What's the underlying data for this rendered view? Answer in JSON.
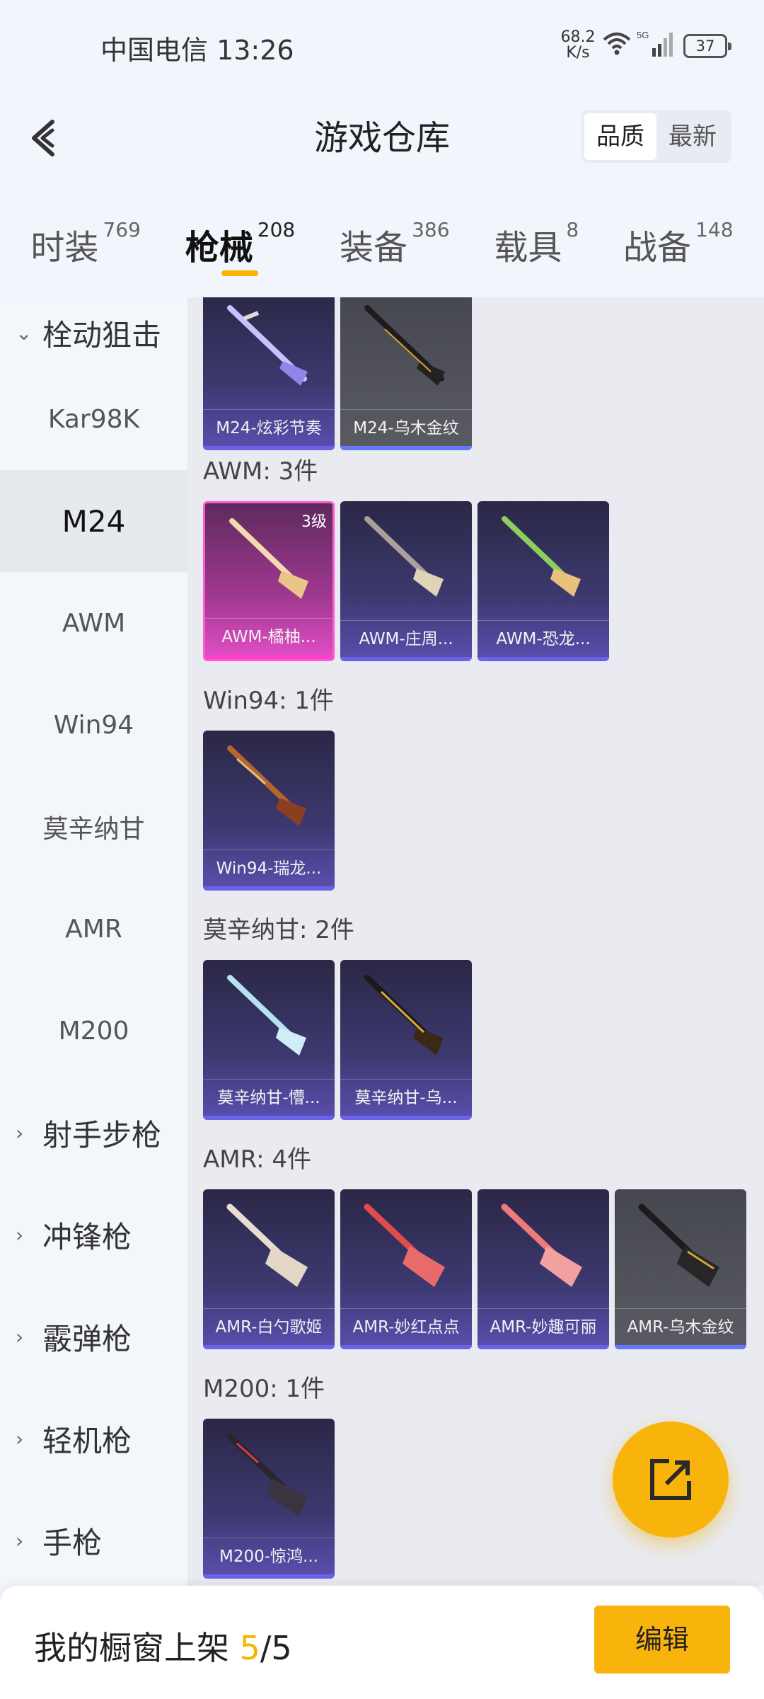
{
  "status": {
    "carrier_time": "中国电信 13:26",
    "net_speed_value": "68.2",
    "net_speed_unit": "K/s",
    "battery": "37"
  },
  "header": {
    "title": "游戏仓库",
    "sort_options": [
      "品质",
      "最新"
    ],
    "sort_selected": "品质"
  },
  "categories": [
    {
      "label": "时装",
      "count": "769"
    },
    {
      "label": "枪械",
      "count": "208",
      "active": true
    },
    {
      "label": "装备",
      "count": "386"
    },
    {
      "label": "载具",
      "count": "8"
    },
    {
      "label": "战备",
      "count": "148"
    }
  ],
  "sidebar": {
    "group_open": "栓动狙击",
    "sub_items": [
      "Kar98K",
      "M24",
      "AWM",
      "Win94",
      "莫辛纳甘",
      "AMR",
      "M200"
    ],
    "selected": "M24",
    "groups_closed": [
      "射手步枪",
      "冲锋枪",
      "霰弹枪",
      "轻机枪",
      "手枪"
    ]
  },
  "sections": [
    {
      "title": "",
      "items": [
        {
          "name": "M24-炫彩节奏",
          "style": "purple"
        },
        {
          "name": "M24-乌木金纹",
          "style": "gray"
        }
      ]
    },
    {
      "title": "AWM: 3件",
      "items": [
        {
          "name": "AWM-橘柚...",
          "style": "pink",
          "level": "3级"
        },
        {
          "name": "AWM-庄周...",
          "style": "purple"
        },
        {
          "name": "AWM-恐龙...",
          "style": "purple"
        }
      ]
    },
    {
      "title": "Win94: 1件",
      "items": [
        {
          "name": "Win94-瑞龙...",
          "style": "purple"
        }
      ]
    },
    {
      "title": "莫辛纳甘: 2件",
      "items": [
        {
          "name": "莫辛纳甘-懵...",
          "style": "purple"
        },
        {
          "name": "莫辛纳甘-乌...",
          "style": "purple"
        }
      ]
    },
    {
      "title": "AMR: 4件",
      "items": [
        {
          "name": "AMR-白勺歌姬",
          "style": "purple"
        },
        {
          "name": "AMR-妙红点点",
          "style": "purple"
        },
        {
          "name": "AMR-妙趣可丽",
          "style": "purple"
        },
        {
          "name": "AMR-乌木金纹",
          "style": "gray"
        }
      ]
    },
    {
      "title": "M200: 1件",
      "items": [
        {
          "name": "M200-惊鸿...",
          "style": "purple"
        }
      ]
    }
  ],
  "bottom": {
    "shelf_label": "我的橱窗上架",
    "shelf_current": "5",
    "shelf_total": "/5",
    "edit_label": "编辑"
  }
}
